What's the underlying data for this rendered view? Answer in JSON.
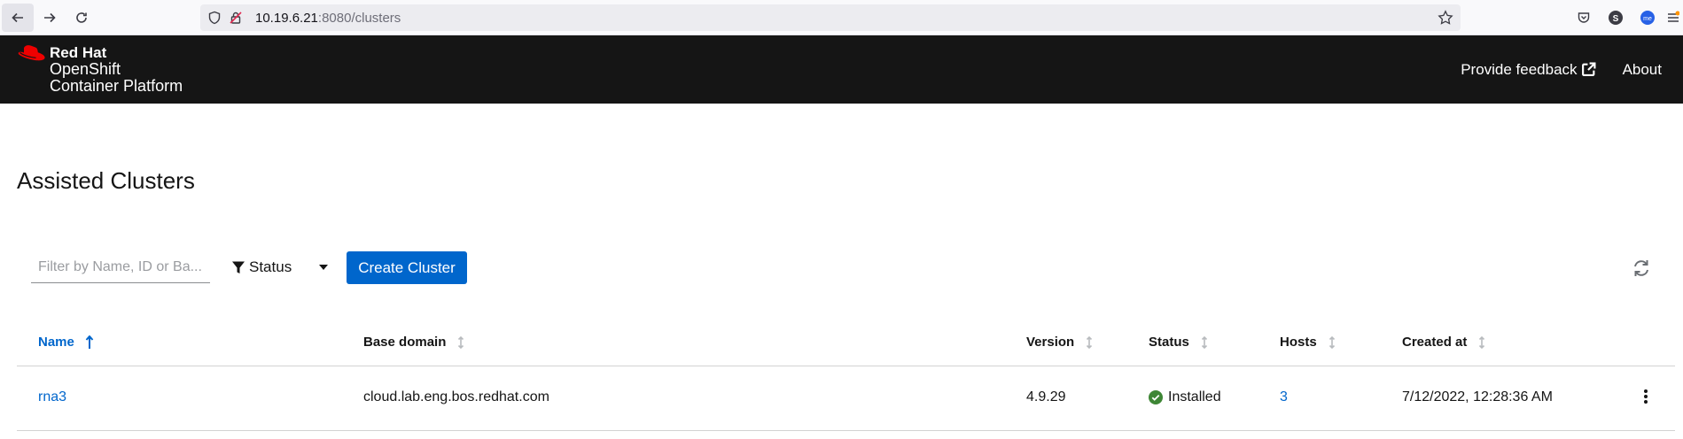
{
  "browser": {
    "url_host": "10.19.6.21",
    "url_rest": ":8080/clusters"
  },
  "masthead": {
    "brand_line1": "Red Hat",
    "brand_line2": "OpenShift",
    "brand_line3": "Container Platform",
    "feedback_label": "Provide feedback",
    "about_label": "About"
  },
  "page": {
    "title": "Assisted Clusters"
  },
  "toolbar": {
    "filter_placeholder": "Filter by Name, ID or Ba...",
    "status_label": "Status",
    "create_label": "Create Cluster"
  },
  "table": {
    "headers": {
      "name": "Name",
      "base_domain": "Base domain",
      "version": "Version",
      "status": "Status",
      "hosts": "Hosts",
      "created_at": "Created at"
    },
    "rows": [
      {
        "name": "rna3",
        "base_domain": "cloud.lab.eng.bos.redhat.com",
        "version": "4.9.29",
        "status": "Installed",
        "hosts": "3",
        "created_at": "7/12/2022, 12:28:36 AM"
      }
    ]
  },
  "colors": {
    "masthead_bg": "#151515",
    "primary": "#0066cc",
    "success": "#3e8635",
    "redhat_red": "#ee0000"
  }
}
